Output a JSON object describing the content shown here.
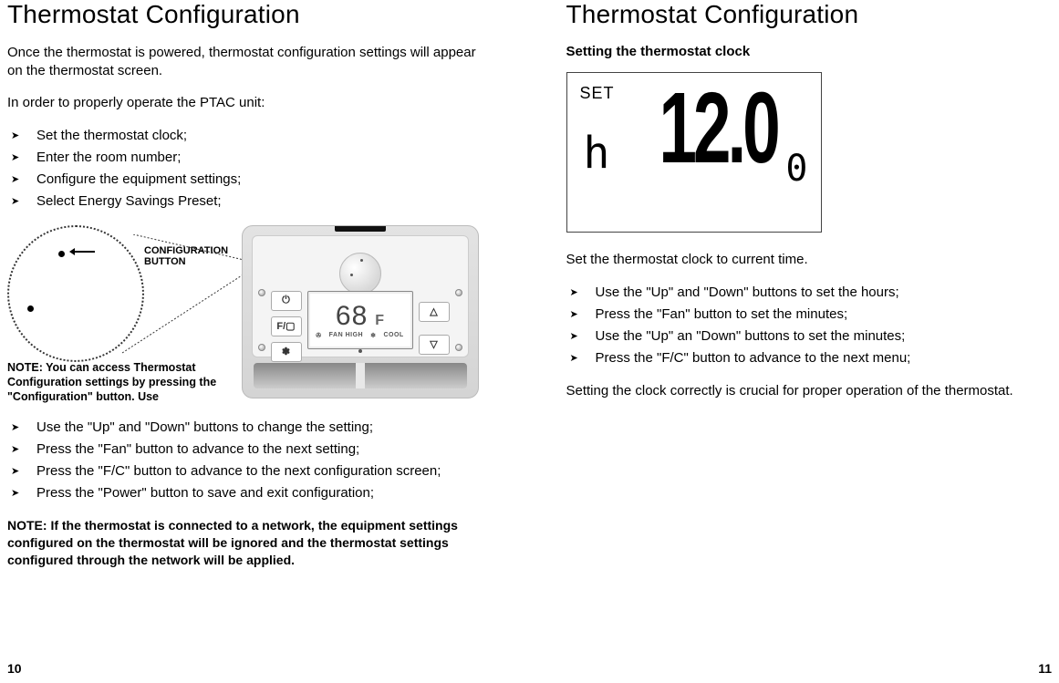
{
  "left": {
    "title": "Thermostat Configuration",
    "intro1": "Once the thermostat is powered, thermostat configuration settings will appear on the thermostat screen.",
    "intro2": "In order to properly operate the PTAC unit:",
    "list1": [
      "Set the thermostat clock;",
      "Enter the room number;",
      "Configure the equipment settings;",
      "Select Energy Savings Preset;"
    ],
    "config_label": "CONFIGURATION BUTTON",
    "note_small": "NOTE: You can access Thermostat Configuration settings by pressing the \"Configuration\" button. Use",
    "device": {
      "temp": "68",
      "unit": "F",
      "fan_text": "FAN HIGH",
      "mode_text": "COOL",
      "btn_power": "⏻",
      "btn_fc": "F/▢",
      "btn_fan": "✽",
      "btn_up": "△",
      "btn_down": "▽"
    },
    "list2": [
      "Use the \"Up\" and \"Down\" buttons to change the setting;",
      "Press the \"Fan\" button to advance to the next setting;",
      "Press the \"F/C\" button to advance to the next configuration screen;",
      "Press the \"Power\" button to save and exit configuration;"
    ],
    "note_bold": "NOTE: If the thermostat is connected to a network, the equipment settings configured on the thermostat will be ignored and the thermostat settings configured through the network will be applied.",
    "page_num": "10"
  },
  "right": {
    "title": "Thermostat Configuration",
    "subheading": "Setting the thermostat clock",
    "lcd": {
      "set": "SET",
      "h": "h",
      "main": "12.0",
      "sub": "0"
    },
    "body1": "Set the thermostat clock to current time.",
    "list": [
      "Use the \"Up\" and \"Down\" buttons to set the hours;",
      "Press the \"Fan\" button to set the minutes;",
      "Use the \"Up\" an \"Down\" buttons to set the minutes;",
      "Press the \"F/C\" button to advance to the next menu;"
    ],
    "body2": "Setting the clock correctly is crucial for proper operation of the thermostat.",
    "page_num": "11"
  }
}
